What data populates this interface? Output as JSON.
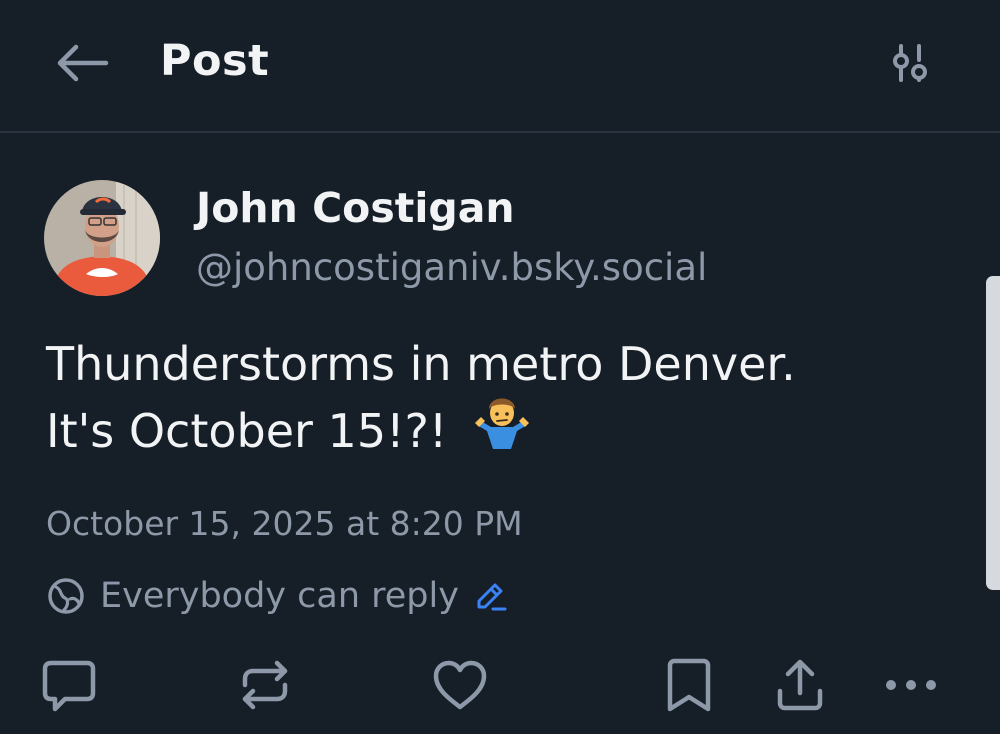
{
  "header": {
    "title": "Post",
    "back_icon": "arrow-left-icon",
    "settings_icon": "sliders-icon"
  },
  "author": {
    "display_name": "John Costigan",
    "handle": "@johncostiganiv.bsky.social",
    "avatar_icon": "user-avatar"
  },
  "post": {
    "lines": [
      "Thunderstorms in metro Denver.",
      "It's October 15!?!"
    ],
    "emoji": "person-shrugging-emoji",
    "timestamp": "October 15, 2025 at 8:20 PM"
  },
  "reply_settings": {
    "label": "Everybody can reply",
    "icon": "globe-icon",
    "edit_icon": "pencil-icon"
  },
  "actions": [
    {
      "name": "reply",
      "icon": "speech-bubble-icon"
    },
    {
      "name": "repost",
      "icon": "repost-icon"
    },
    {
      "name": "like",
      "icon": "heart-icon"
    },
    {
      "name": "bookmark",
      "icon": "bookmark-icon"
    },
    {
      "name": "share",
      "icon": "share-icon"
    },
    {
      "name": "more",
      "icon": "ellipsis-icon"
    }
  ],
  "colors": {
    "background": "#161e27",
    "primary_text": "#f1f3f5",
    "secondary_text": "#8d99a8",
    "icon": "#8d99a8",
    "accent": "#3b82f6",
    "divider": "#2a3441"
  }
}
